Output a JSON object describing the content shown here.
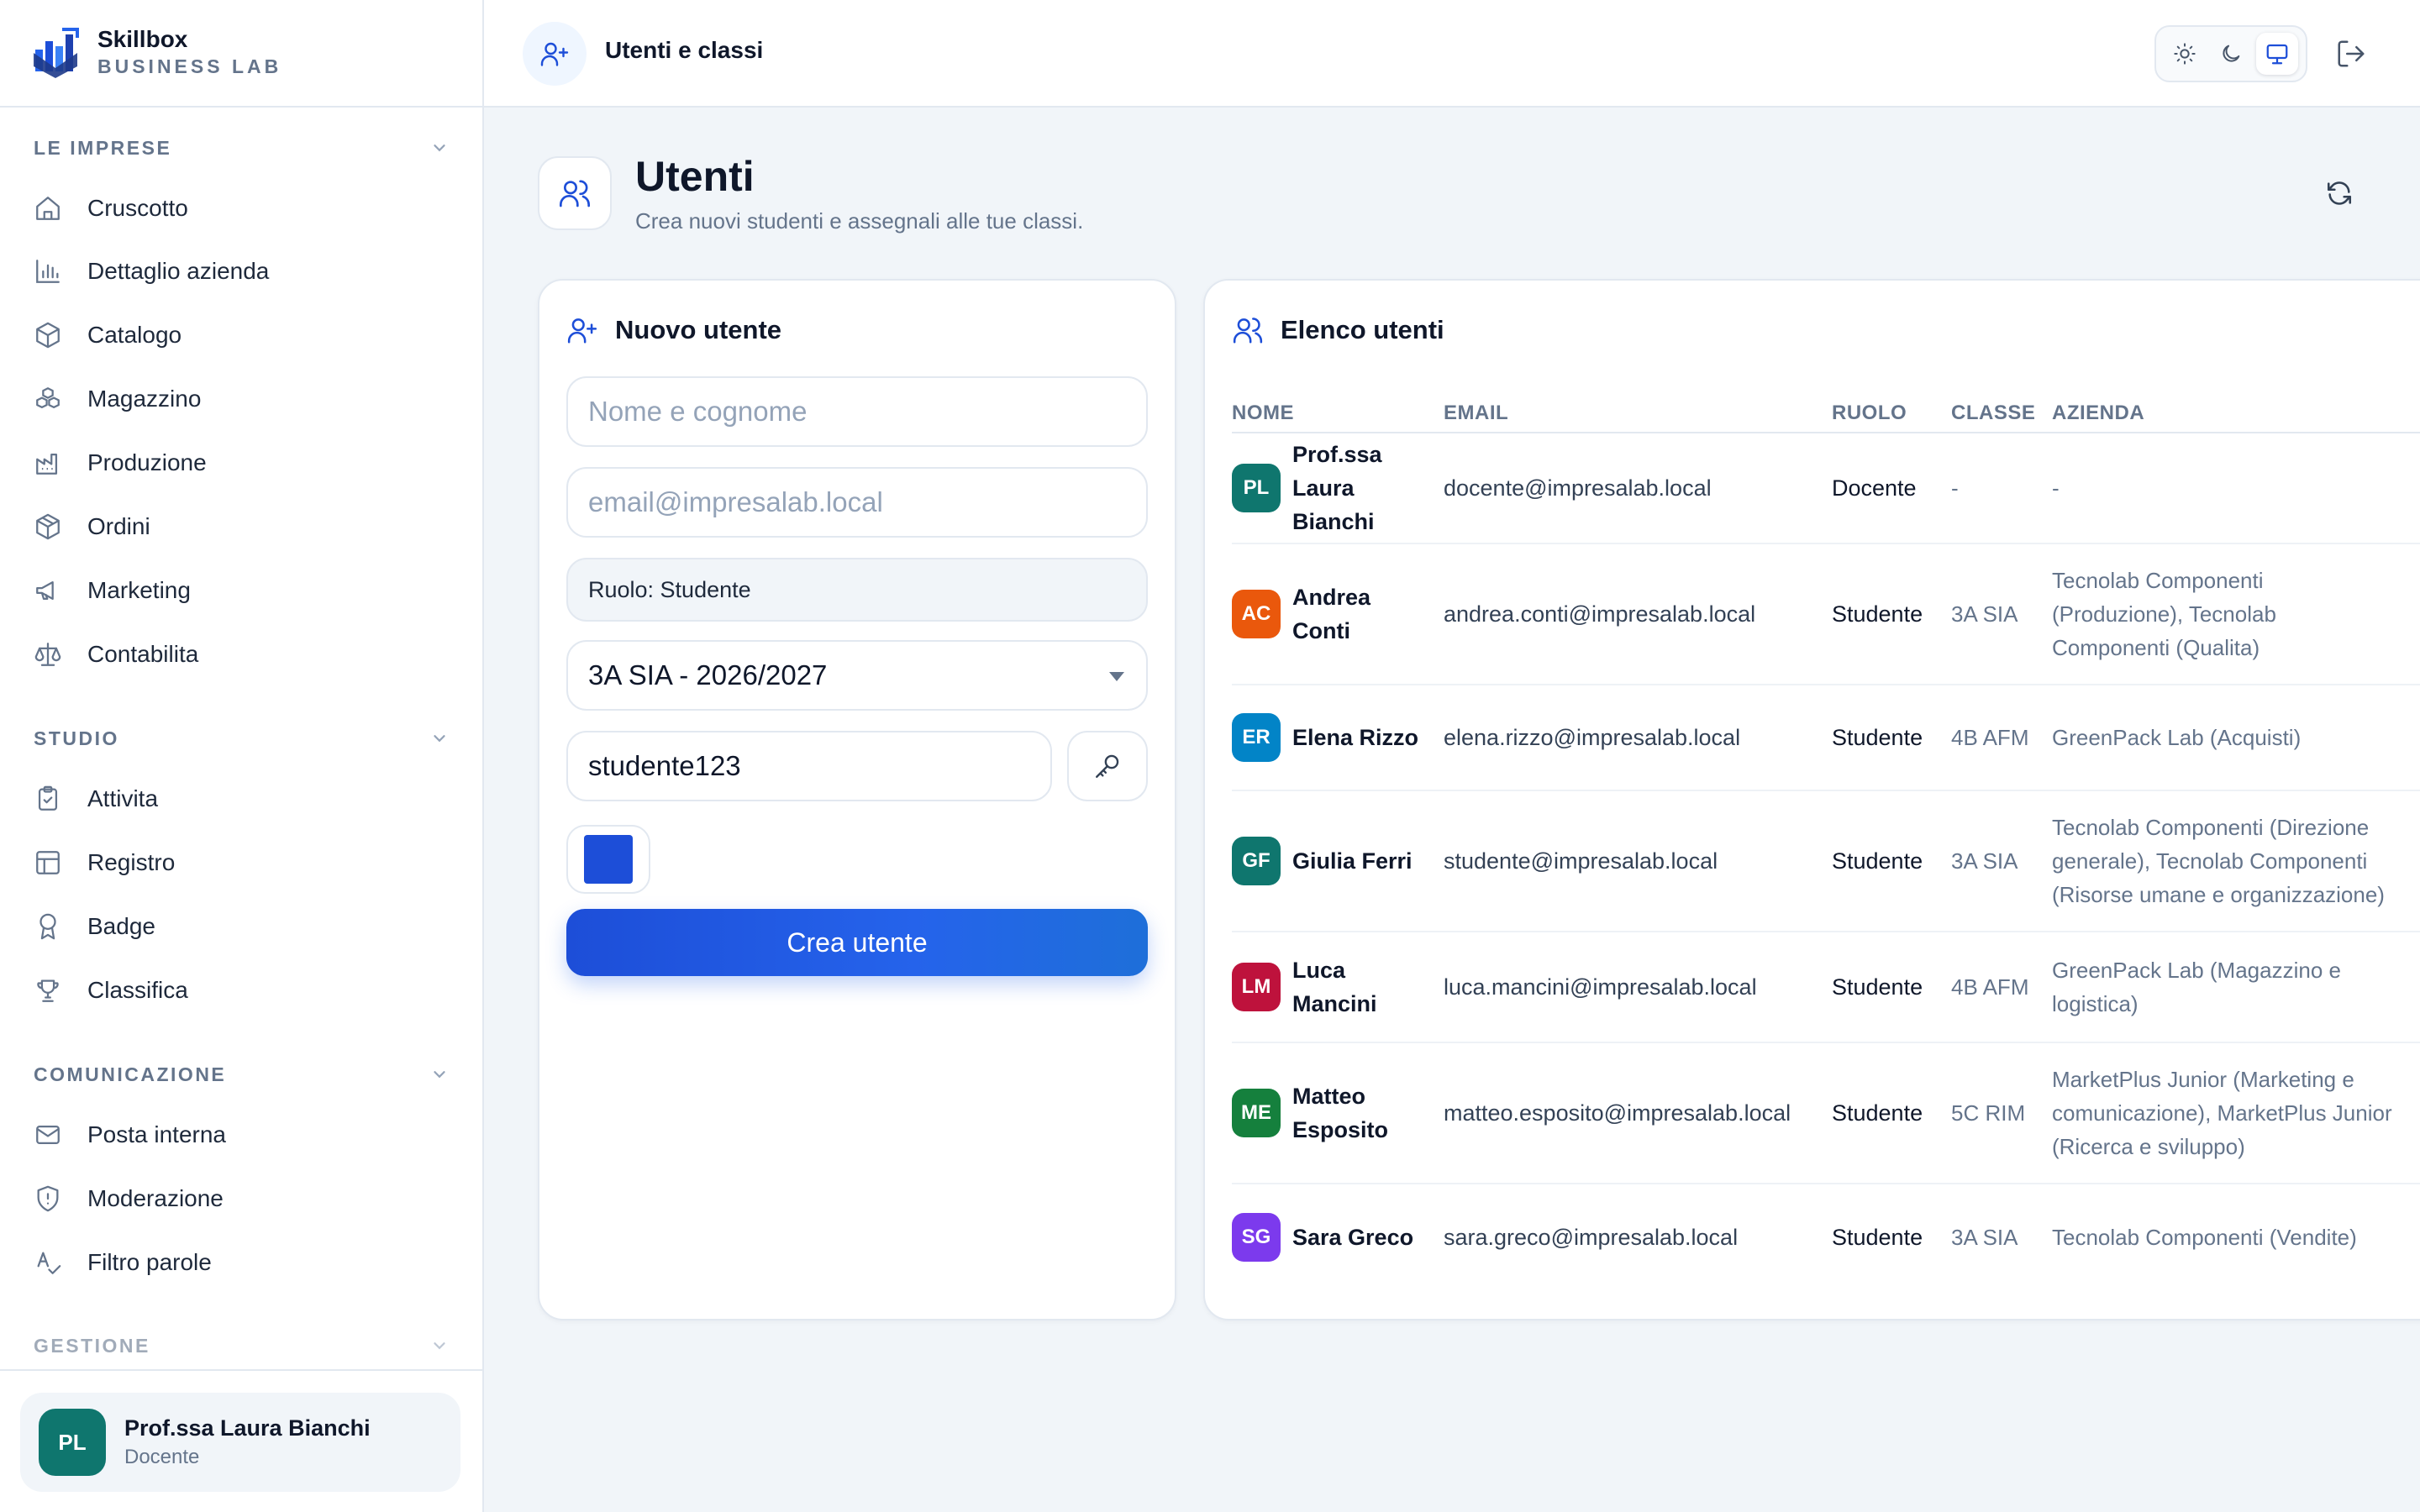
{
  "brand": {
    "name": "Skillbox",
    "subtitle": "BUSINESS LAB"
  },
  "sidebar": {
    "sections": [
      {
        "title": "LE IMPRESE",
        "items": [
          {
            "label": "Cruscotto",
            "icon": "home-icon"
          },
          {
            "label": "Dettaglio azienda",
            "icon": "bar-chart-icon"
          },
          {
            "label": "Catalogo",
            "icon": "box-icon"
          },
          {
            "label": "Magazzino",
            "icon": "boxes-icon"
          },
          {
            "label": "Produzione",
            "icon": "factory-icon"
          },
          {
            "label": "Ordini",
            "icon": "package-icon"
          },
          {
            "label": "Marketing",
            "icon": "megaphone-icon"
          },
          {
            "label": "Contabilita",
            "icon": "scale-icon"
          }
        ]
      },
      {
        "title": "STUDIO",
        "items": [
          {
            "label": "Attivita",
            "icon": "clipboard-check-icon"
          },
          {
            "label": "Registro",
            "icon": "table-icon"
          },
          {
            "label": "Badge",
            "icon": "award-icon"
          },
          {
            "label": "Classifica",
            "icon": "trophy-icon"
          }
        ]
      },
      {
        "title": "COMUNICAZIONE",
        "items": [
          {
            "label": "Posta interna",
            "icon": "mail-icon"
          },
          {
            "label": "Moderazione",
            "icon": "shield-alert-icon"
          },
          {
            "label": "Filtro parole",
            "icon": "spell-check-icon"
          }
        ]
      },
      {
        "title": "GESTIONE",
        "items": []
      }
    ],
    "user": {
      "initials": "PL",
      "name": "Prof.ssa Laura Bianchi",
      "role": "Docente"
    }
  },
  "topbar": {
    "title": "Utenti e classi",
    "icon": "user-plus-icon",
    "theme_options": [
      "sun-icon",
      "moon-icon",
      "monitor-icon"
    ],
    "active_theme": "monitor-icon"
  },
  "page": {
    "title": "Utenti",
    "subtitle": "Crea nuovi studenti e assegnali alle tue classi."
  },
  "form": {
    "title": "Nuovo utente",
    "name_placeholder": "Nome e cognome",
    "email_placeholder": "email@impresalab.local",
    "role_text": "Ruolo: Studente",
    "class_selected": "3A SIA - 2026/2027",
    "password_value": "studente123",
    "color_value": "#1d4ed8",
    "submit_label": "Crea utente"
  },
  "users_list": {
    "title": "Elenco utenti",
    "columns": [
      "NOME",
      "EMAIL",
      "RUOLO",
      "CLASSE",
      "AZIENDA"
    ],
    "rows": [
      {
        "initials": "PL",
        "color": "#0f766e",
        "name_lines": [
          "Prof.ssa",
          "Laura Bianchi"
        ],
        "email": "docente@impresalab.local",
        "role": "Docente",
        "class": "-",
        "company_lines": [
          "-"
        ]
      },
      {
        "initials": "AC",
        "color": "#ea580c",
        "name_lines": [
          "Andrea",
          "Conti"
        ],
        "email": "andrea.conti@impresalab.local",
        "role": "Studente",
        "class": "3A SIA",
        "company_lines": [
          "Tecnolab Componenti",
          "(Produzione), Tecnolab",
          "Componenti (Qualita)"
        ]
      },
      {
        "initials": "ER",
        "color": "#0284c7",
        "name_lines": [
          "Elena Rizzo"
        ],
        "email": "elena.rizzo@impresalab.local",
        "role": "Studente",
        "class": "4B AFM",
        "company_lines": [
          "GreenPack Lab (Acquisti)"
        ]
      },
      {
        "initials": "GF",
        "color": "#0f766e",
        "name_lines": [
          "Giulia Ferri"
        ],
        "email": "studente@impresalab.local",
        "role": "Studente",
        "class": "3A SIA",
        "company_lines": [
          "Tecnolab Componenti (Direzione",
          "generale), Tecnolab Componenti",
          "(Risorse umane e organizzazione)"
        ]
      },
      {
        "initials": "LM",
        "color": "#be123c",
        "name_lines": [
          "Luca",
          "Mancini"
        ],
        "email": "luca.mancini@impresalab.local",
        "role": "Studente",
        "class": "4B AFM",
        "company_lines": [
          "GreenPack Lab (Magazzino e",
          "logistica)"
        ]
      },
      {
        "initials": "ME",
        "color": "#15803d",
        "name_lines": [
          "Matteo",
          "Esposito"
        ],
        "email": "matteo.esposito@impresalab.local",
        "role": "Studente",
        "class": "5C RIM",
        "company_lines": [
          "MarketPlus Junior (Marketing e",
          "comunicazione), MarketPlus Junior",
          "(Ricerca e sviluppo)"
        ]
      },
      {
        "initials": "SG",
        "color": "#7c3aed",
        "name_lines": [
          "Sara Greco"
        ],
        "email": "sara.greco@impresalab.local",
        "role": "Studente",
        "class": "3A SIA",
        "company_lines": [
          "Tecnolab Componenti (Vendite)"
        ]
      }
    ]
  }
}
